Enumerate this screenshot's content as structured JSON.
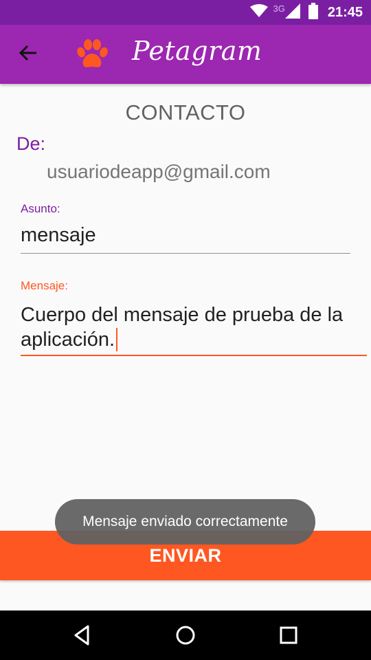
{
  "status_bar": {
    "network": "3G",
    "time": "21:45",
    "icons": [
      "wifi-icon",
      "signal-icon",
      "battery-icon"
    ]
  },
  "toolbar": {
    "back_icon": "arrow-back-icon",
    "logo_icon": "paw-icon",
    "title": "Petagram"
  },
  "form": {
    "heading": "CONTACTO",
    "from_label": "De:",
    "from_value": "usuariodeapp@gmail.com",
    "subject_label": "Asunto:",
    "subject_value": "mensaje",
    "message_label": "Mensaje:",
    "message_value": "Cuerpo del mensaje de prueba de la aplicación."
  },
  "send_button": {
    "label": "ENVIAR"
  },
  "toast": {
    "text": "Mensaje enviado correctamente"
  },
  "nav_bar": {
    "icons": [
      "nav-back-icon",
      "nav-home-icon",
      "nav-recents-icon"
    ]
  },
  "colors": {
    "primary": "#9c27b0",
    "primary_dark": "#7b1fa2",
    "accent": "#ff5722"
  }
}
